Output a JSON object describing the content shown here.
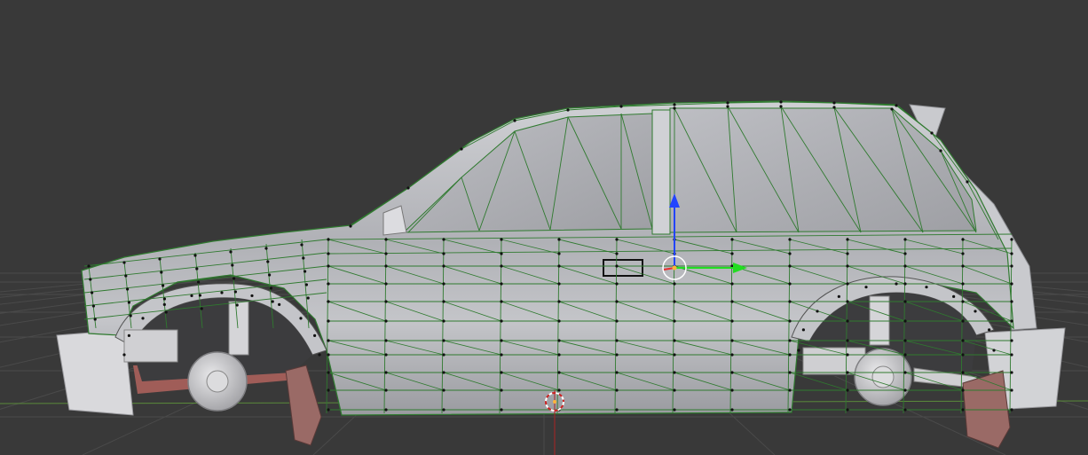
{
  "viewport": {
    "background": "#393939",
    "grid_color": "#4a4a4a",
    "x_axis_color": "#7a3a3a",
    "y_axis_color": "#5a8a3a"
  },
  "scene": {
    "object": {
      "body_color": "#b4b5ba",
      "body_highlight": "#d8d9dd",
      "body_shadow": "#8c8d92",
      "wire_color": "#2f7a2f",
      "vertex_color": "#111111",
      "wheel_color": "#c9c9cc",
      "mudflap_color": "#9a6a66",
      "undertray_color": "#a05d58"
    },
    "gizmo": {
      "x_axis_color": "#e83030",
      "y_axis_color": "#22dd22",
      "z_axis_color": "#2244ff",
      "center_color": "#ffffff"
    },
    "cursor_3d": {
      "ring_color_a": "#ffffff",
      "ring_color_b": "#cc2222"
    }
  }
}
